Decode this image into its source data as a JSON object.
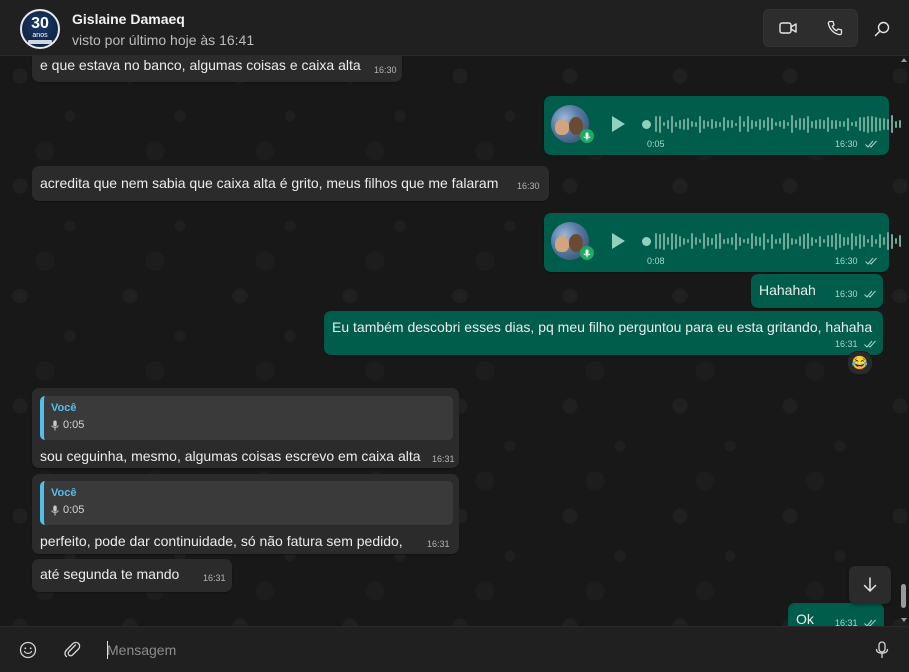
{
  "header": {
    "avatar": {
      "number": "30",
      "word": "anos"
    },
    "name": "Gislaine Damaeq",
    "status": "visto por último hoje às 16:41",
    "icons": {
      "video": "video-camera-icon",
      "phone": "phone-icon",
      "search": "search-icon"
    }
  },
  "messages": [
    {
      "id": "m1",
      "dir": "in",
      "type": "text",
      "text": "e que estava no banco, algumas coisas e caixa alta",
      "time": "16:30"
    },
    {
      "id": "m2",
      "dir": "out",
      "type": "voice",
      "duration": "0:05",
      "time": "16:30",
      "status": "read"
    },
    {
      "id": "m3",
      "dir": "in",
      "type": "text",
      "text": "acredita que nem sabia que caixa alta é grito, meus filhos que me falaram",
      "time": "16:30"
    },
    {
      "id": "m4",
      "dir": "out",
      "type": "voice",
      "duration": "0:08",
      "time": "16:30",
      "status": "read"
    },
    {
      "id": "m5",
      "dir": "out",
      "type": "text",
      "text": "Hahahah",
      "time": "16:30",
      "status": "read"
    },
    {
      "id": "m6",
      "dir": "out",
      "type": "text",
      "text": "Eu também descobri esses dias, pq meu filho perguntou para eu esta gritando, hahaha",
      "time": "16:31",
      "status": "read",
      "reaction": "😂"
    },
    {
      "id": "m7",
      "dir": "in",
      "type": "reply",
      "quote_author": "Você",
      "quote_duration": "0:05",
      "text": "sou ceguinha, mesmo, algumas coisas escrevo em caixa alta",
      "time": "16:31"
    },
    {
      "id": "m8",
      "dir": "in",
      "type": "reply",
      "quote_author": "Você",
      "quote_duration": "0:05",
      "text": "perfeito, pode dar continuidade, só não fatura sem pedido,",
      "time": "16:31"
    },
    {
      "id": "m9",
      "dir": "in",
      "type": "text",
      "text": "até segunda te mando",
      "time": "16:31"
    },
    {
      "id": "m10",
      "dir": "out",
      "type": "text",
      "text": "Ok",
      "time": "16:31",
      "status": "read"
    }
  ],
  "composer": {
    "placeholder": "Mensagem",
    "icons": {
      "emoji": "emoji-icon",
      "attach": "paperclip-icon",
      "mic": "microphone-icon"
    }
  },
  "colors": {
    "incoming_bubble": "#2b2b2b",
    "outgoing_bubble": "#005c4b",
    "quote_accent": "#53bdeb",
    "mic_badge": "#1daa61",
    "read_ticks": "#a8d8c9"
  }
}
